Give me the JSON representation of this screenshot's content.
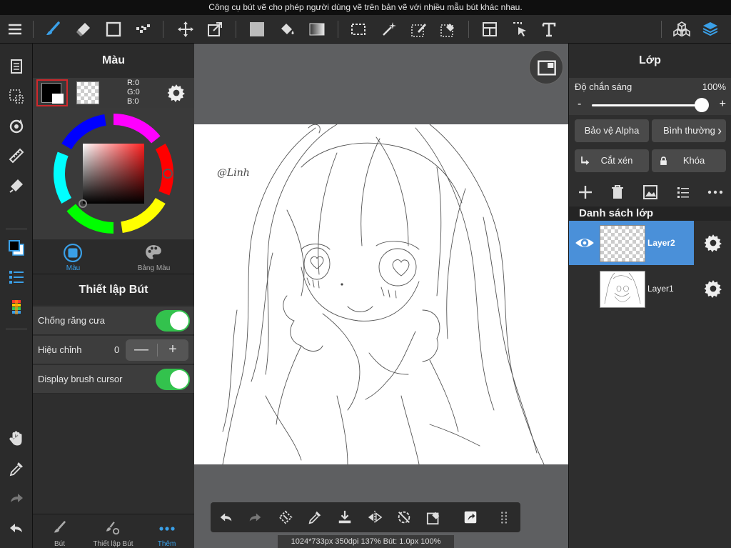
{
  "hint": "Công cụ bút vẽ cho phép người dùng vẽ trên bản vẽ với nhiều mẫu bút khác nhau.",
  "color_panel": {
    "title": "Màu",
    "rgb": {
      "r": "R:0",
      "g": "G:0",
      "b": "B:0"
    },
    "tabs": [
      "Màu",
      "Bảng Màu"
    ]
  },
  "pen_settings": {
    "title": "Thiết lập Bút",
    "antialias_label": "Chống răng cưa",
    "correction_label": "Hiệu chỉnh",
    "correction_value": "0",
    "stepper_minus": "—",
    "stepper_plus": "+",
    "cursor_label": "Display brush cursor"
  },
  "bottom_tabs": [
    "Bút",
    "Thiết lập Bút",
    "Thêm"
  ],
  "status": "1024*733px 350dpi 137% Bút: 1.0px 100%",
  "canvas": {
    "signature": "@Linh"
  },
  "layers_panel": {
    "title": "Lớp",
    "opacity_label": "Độ chắn sáng",
    "opacity_value": "100%",
    "opacity_fraction": 1.0,
    "slider_minus": "-",
    "slider_plus": "+",
    "alpha_protect": "Bảo vệ Alpha",
    "blend_mode": "Bình thường",
    "blend_chevron": "›",
    "clipping": "Cắt xén",
    "lock": "Khóa",
    "list_title": "Danh sách lớp",
    "layers": [
      {
        "name": "Layer2",
        "selected": true,
        "visible": true
      },
      {
        "name": "Layer1",
        "selected": false,
        "visible": false
      }
    ]
  },
  "colors": {
    "accent": "#4a90d9",
    "toggle_on": "#33c24d",
    "active_icon": "#3aa0e8"
  },
  "icons": {
    "toolbar": [
      "menu-icon",
      "brush-icon",
      "eraser-icon",
      "rectangle-icon",
      "dotted-brush-icon",
      "move-icon",
      "transform-icon",
      "fill-color-icon",
      "bucket-icon",
      "gradient-icon",
      "selection-icon",
      "magic-wand-icon",
      "select-pen-icon",
      "select-eraser-icon",
      "layout-icon",
      "selection-move-icon",
      "text-icon",
      "materials-icon",
      "layers-icon"
    ]
  }
}
